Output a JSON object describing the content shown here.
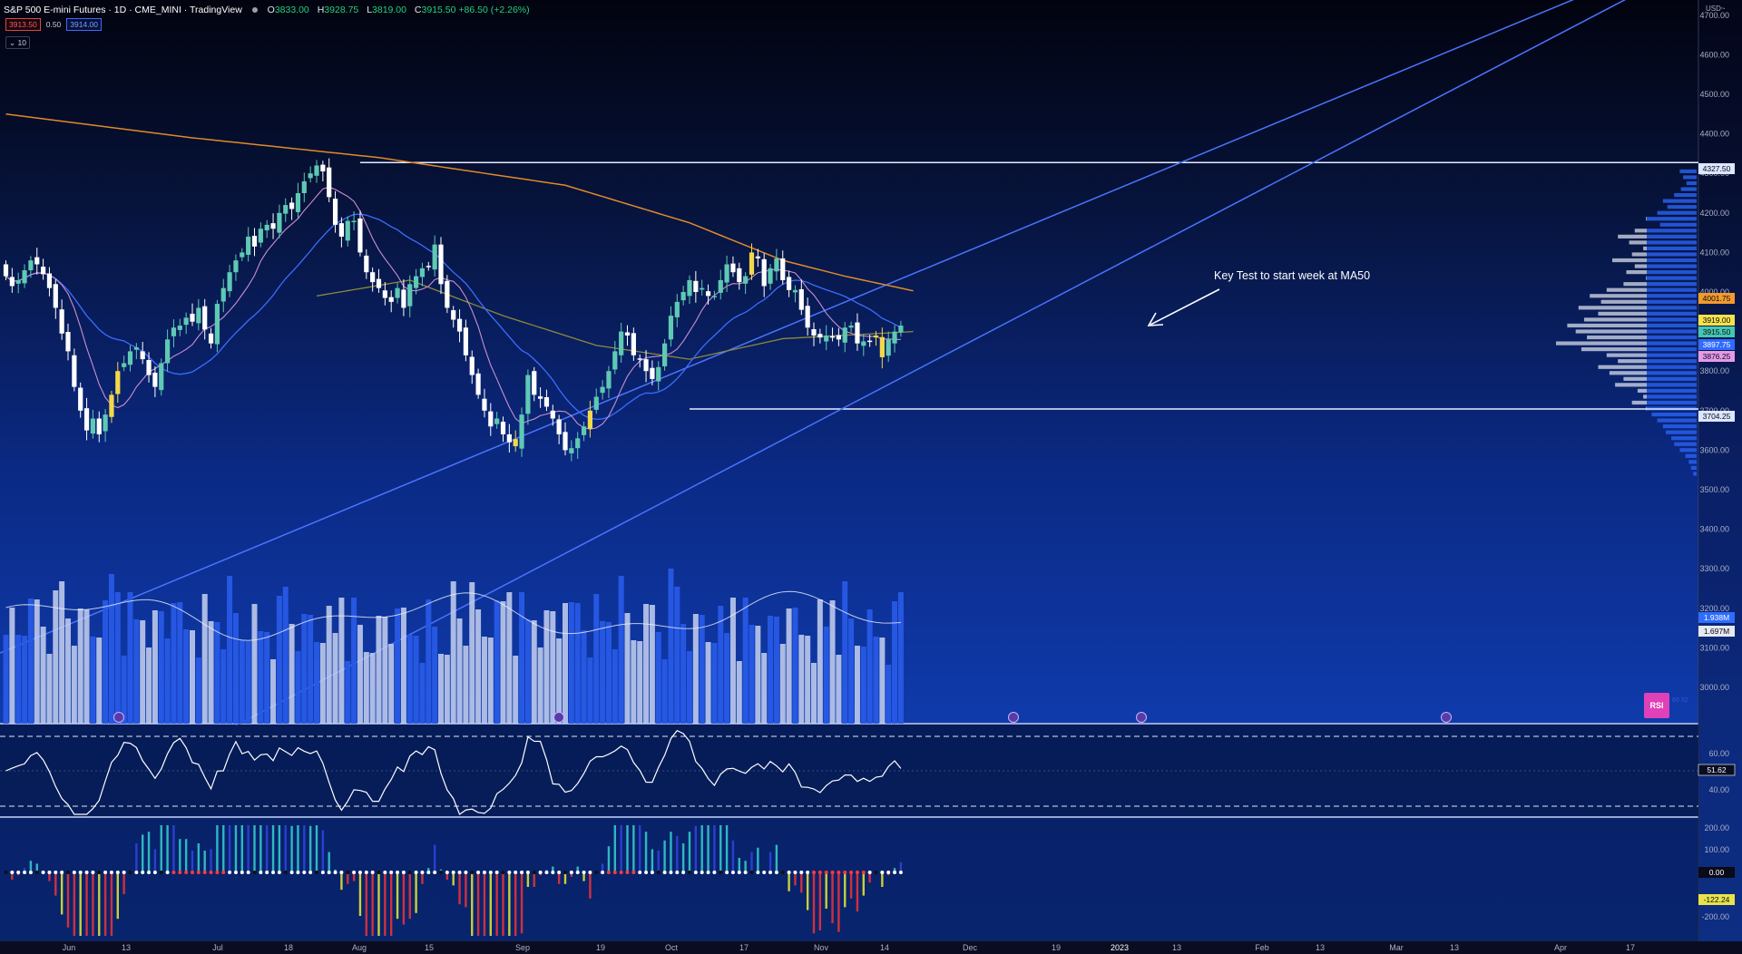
{
  "header": {
    "title": "S&P 500 E-mini Futures · 1D · CME_MINI · TradingView",
    "open_label": "O",
    "open": "3833.00",
    "high_label": "H",
    "high": "3928.75",
    "low_label": "L",
    "low": "3819.00",
    "close_label": "C",
    "close": "3915.50",
    "change": "+86.50 (+2.26%)",
    "bid": "3913.50",
    "spread": "0.50",
    "ask": "3914.00",
    "collapse_label": "⌄ 10"
  },
  "annotation": "Key Test to start week at MA50",
  "currency": "USD~",
  "price_axis_ticks": [
    "4700.00",
    "4600.00",
    "4500.00",
    "4400.00",
    "4300.00",
    "4200.00",
    "4100.00",
    "4000.00",
    "3900.00",
    "3800.00",
    "3700.00",
    "3600.00",
    "3500.00",
    "3400.00",
    "3300.00",
    "3200.00",
    "3100.00",
    "3000.00"
  ],
  "price_tags": [
    {
      "label": "4327.50",
      "color": "#dbe6ff"
    },
    {
      "label": "4001.75",
      "color": "#f39a2c"
    },
    {
      "label": "3919.00",
      "color": "#f7e24a"
    },
    {
      "label": "3915.50",
      "color": "#45c6b1"
    },
    {
      "label": "3897.75",
      "color": "#2f6cff"
    },
    {
      "label": "3876.25",
      "color": "#e59ae8"
    },
    {
      "label": "3704.25",
      "color": "#dbe6ff"
    },
    {
      "label": "1.938M",
      "color": "#2f6cff"
    },
    {
      "label": "1.697M",
      "color": "#e6e8ef"
    }
  ],
  "rsi": {
    "button_label": "RSI",
    "side_text": "60 32",
    "value": "51.62",
    "ticks": [
      "60.00",
      "40.00"
    ]
  },
  "oscillator": {
    "value_zero": "0.00",
    "value": "-122.24",
    "ticks": [
      "200.00",
      "100.00",
      "-200.00"
    ]
  },
  "time_axis": [
    "Jun",
    "13",
    "Jul",
    "18",
    "Aug",
    "15",
    "Sep",
    "19",
    "Oct",
    "17",
    "Nov",
    "14",
    "Dec",
    "19",
    "2023",
    "13",
    "Feb",
    "13",
    "Mar",
    "13",
    "Apr",
    "17"
  ],
  "colors": {
    "up": "#5fc9b4",
    "down": "#ffffff",
    "yellow": "#f3d94a",
    "ma_orange": "#e08a2a",
    "ma_olive": "#8c8a3a",
    "ma_blue": "#3d6cff",
    "ma_pink": "#c98fd0",
    "trend": "#4a74ff",
    "level": "#e6ecff"
  },
  "chart_data": {
    "type": "candlestick",
    "price_range": [
      2930,
      4740
    ],
    "levels": [
      4327.5,
      3704.25
    ],
    "closes": [
      4040,
      4015,
      4030,
      4055,
      4080,
      4070,
      4045,
      4010,
      3960,
      3895,
      3850,
      3760,
      3700,
      3650,
      3680,
      3640,
      3690,
      3740,
      3800,
      3820,
      3850,
      3860,
      3830,
      3790,
      3760,
      3820,
      3880,
      3910,
      3915,
      3935,
      3925,
      3960,
      3905,
      3870,
      3970,
      4010,
      4050,
      4080,
      4100,
      4140,
      4115,
      4160,
      4170,
      4160,
      4200,
      4220,
      4210,
      4250,
      4280,
      4300,
      4320,
      4305,
      4240,
      4170,
      4140,
      4180,
      4180,
      4100,
      4050,
      4025,
      4010,
      3985,
      3975,
      4010,
      3960,
      4020,
      4040,
      4060,
      4065,
      4120,
      4020,
      3960,
      3930,
      3900,
      3840,
      3790,
      3740,
      3700,
      3660,
      3680,
      3640,
      3620,
      3610,
      3690,
      3790,
      3740,
      3730,
      3710,
      3680,
      3640,
      3600,
      3605,
      3630,
      3660,
      3700,
      3735,
      3760,
      3800,
      3850,
      3900,
      3890,
      3840,
      3830,
      3800,
      3780,
      3810,
      3870,
      3940,
      3975,
      4000,
      4030,
      4000,
      4010,
      3990,
      3990,
      4030,
      4070,
      4050,
      4025,
      4040,
      4100,
      4085,
      4015,
      4060,
      4085,
      4030,
      4005,
      4005,
      3955,
      3910,
      3890,
      3885,
      3890,
      3885,
      3880,
      3910,
      3915,
      3870,
      3875,
      3875,
      3890,
      3835,
      3880,
      3900,
      3915
    ],
    "ma_slow_anchors": [
      [
        0,
        4450
      ],
      [
        30,
        4390
      ],
      [
        60,
        4340
      ],
      [
        90,
        4270
      ],
      [
        110,
        4175
      ],
      [
        125,
        4080
      ],
      [
        135,
        4040
      ],
      [
        146,
        4003
      ]
    ],
    "ma50_anchors": [
      [
        50,
        3990
      ],
      [
        65,
        4030
      ],
      [
        80,
        3940
      ],
      [
        95,
        3865
      ],
      [
        110,
        3830
      ],
      [
        125,
        3882
      ],
      [
        146,
        3900
      ]
    ],
    "volume_avg": 1.697,
    "volume_last": 1.938,
    "rsi_last": 51.62,
    "osc_last": -122.24
  }
}
